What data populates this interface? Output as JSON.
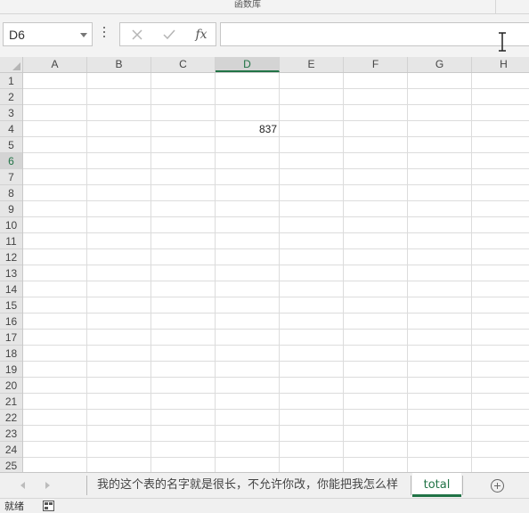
{
  "ribbon": {
    "group_label": "函数库"
  },
  "name_box": {
    "value": "D6"
  },
  "formula_bar": {
    "cancel_icon": "x-icon",
    "enter_icon": "check-icon",
    "fx_label": "fx",
    "value": ""
  },
  "columns": [
    "A",
    "B",
    "C",
    "D",
    "E",
    "F",
    "G",
    "H"
  ],
  "rows": [
    "1",
    "2",
    "3",
    "4",
    "5",
    "6",
    "7",
    "8",
    "9",
    "10",
    "11",
    "12",
    "13",
    "14",
    "15",
    "16",
    "17",
    "18",
    "19",
    "20",
    "21",
    "22",
    "23",
    "24",
    "25"
  ],
  "active_cell": "D6",
  "cells": [
    {
      "ref": "D4",
      "value": "837"
    }
  ],
  "sheet_tabs": [
    {
      "label": "我的这个表的名字就是很长，不允许你改，你能把我怎么样",
      "active": false
    },
    {
      "label": "total",
      "active": true
    }
  ],
  "status_bar": {
    "text": "就绪"
  },
  "colors": {
    "accent": "#217346",
    "gridline": "#dcdcdc",
    "header_bg": "#e6e6e6"
  }
}
